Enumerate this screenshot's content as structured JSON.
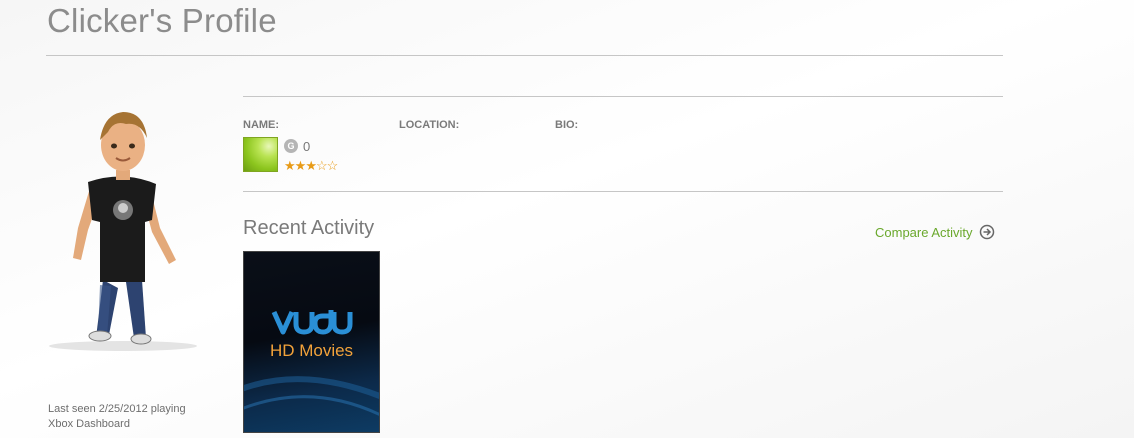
{
  "header": {
    "title": "Clicker's Profile"
  },
  "profile": {
    "last_seen": "Last seen 2/25/2012 playing",
    "last_seen_title": "Xbox Dashboard",
    "fields": {
      "name_label": "NAME:",
      "location_label": "LOCATION:",
      "bio_label": "BIO:"
    },
    "gamerscore_icon": "G",
    "gamerscore": "0",
    "reputation_stars": 3,
    "reputation_max": 5,
    "colors": {
      "star": "#e89b17",
      "link": "#6aa82c"
    }
  },
  "activity": {
    "heading": "Recent Activity",
    "compare_label": "Compare Activity",
    "compare_icon": "arrow-circle-right-icon",
    "tiles": [
      {
        "logo": "vudu",
        "subtitle": "HD Movies"
      }
    ]
  }
}
